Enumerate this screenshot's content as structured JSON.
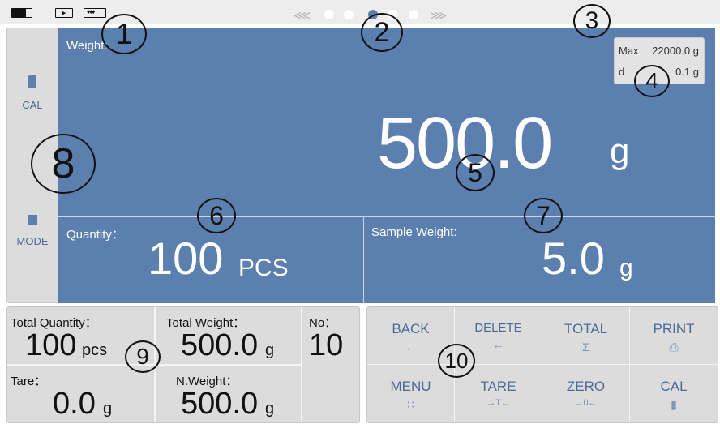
{
  "status": {
    "battery_icon": "battery-icon",
    "media_icon": "play-icon",
    "signal_icon": "signal-icon",
    "page_dots": 6,
    "active_dot": 3
  },
  "sidebar": {
    "cal_label": "CAL",
    "mode_label": "MODE"
  },
  "display": {
    "weight_label": "Weight:",
    "max_label": "Max",
    "max_value": "22000.0 g",
    "d_label": "d",
    "d_value": "0.1 g",
    "weight_value": "500.0",
    "weight_unit": "g",
    "quantity_label": "Quantity：",
    "quantity_value": "100",
    "quantity_unit": "PCS",
    "sample_label": "Sample Weight:",
    "sample_value": "5.0",
    "sample_unit": "g"
  },
  "info": {
    "total_quantity_label": "Total Quantity：",
    "total_quantity_value": "100",
    "total_quantity_unit": "pcs",
    "total_weight_label": "Total Weight：",
    "total_weight_value": "500.0",
    "total_weight_unit": "g",
    "no_label": "No：",
    "no_value": "10",
    "tare_label": "Tare：",
    "tare_value": "0.0",
    "tare_unit": "g",
    "nweight_label": "N.Weight：",
    "nweight_value": "500.0",
    "nweight_unit": "g"
  },
  "keypad": {
    "back": "BACK",
    "back_sym": "←",
    "delete": "DELETE",
    "delete_sym": "←",
    "total": "TOTAL",
    "total_sym": "Σ",
    "print": "PRINT",
    "print_sym": "⎙",
    "menu": "MENU",
    "menu_sym": "∷",
    "tare": "TARE",
    "tare_sym": "→T←",
    "zero": "ZERO",
    "zero_sym": "→0←",
    "cal": "CAL",
    "cal_sym": "▮"
  },
  "callouts": [
    "1",
    "2",
    "3",
    "4",
    "5",
    "6",
    "7",
    "8",
    "9",
    "10"
  ]
}
